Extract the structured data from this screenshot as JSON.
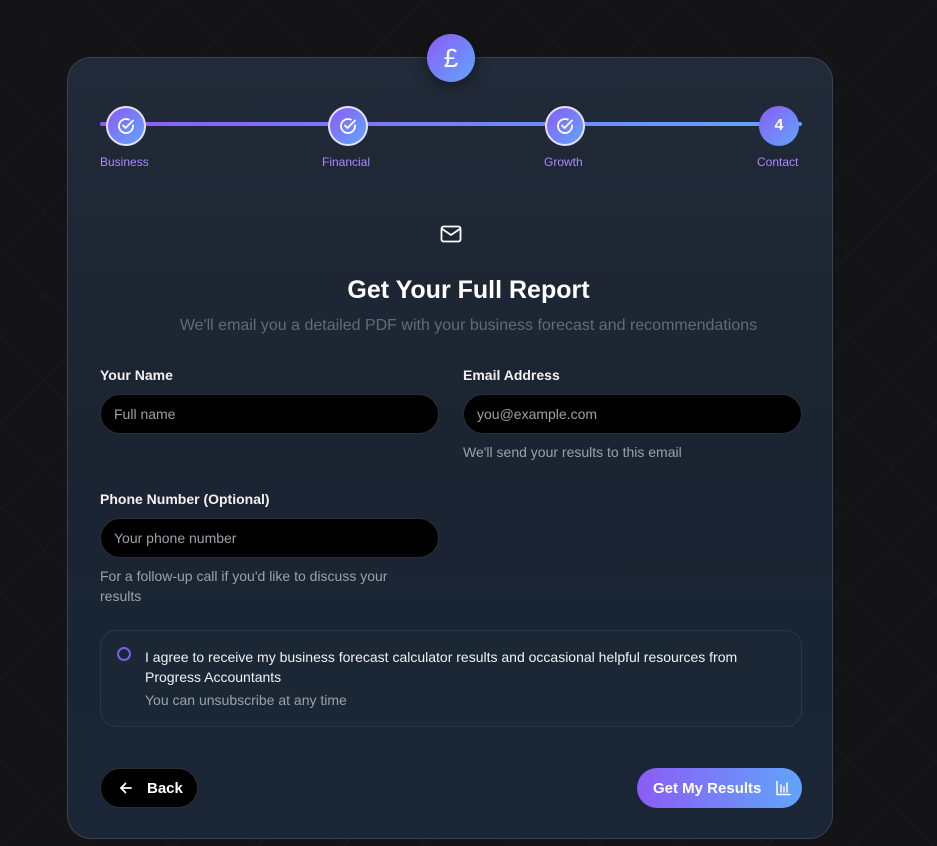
{
  "badge": {
    "symbol": "£",
    "icon": "pound-icon"
  },
  "steps": [
    {
      "label": "Business",
      "state": "done"
    },
    {
      "label": "Financial",
      "state": "done"
    },
    {
      "label": "Growth",
      "state": "done"
    },
    {
      "label": "Contact",
      "state": "current",
      "number": "4"
    }
  ],
  "header": {
    "icon": "mail-icon",
    "title": "Get Your Full Report",
    "subtitle": "We'll email you a detailed PDF with your business forecast and recommendations"
  },
  "form": {
    "name": {
      "label": "Your Name",
      "placeholder": "Full name"
    },
    "email": {
      "label": "Email Address",
      "placeholder": "you@example.com",
      "hint": "We'll send your results to this email"
    },
    "phone": {
      "label": "Phone Number (Optional)",
      "placeholder": "Your phone number",
      "hint": "For a follow-up call if you'd like to discuss your results"
    }
  },
  "consent": {
    "text": "I agree to receive my business forecast calculator results and occasional helpful resources from Progress Accountants",
    "subtext": "You can unsubscribe at any time"
  },
  "actions": {
    "back_label": "Back",
    "submit_label": "Get My Results"
  },
  "colors": {
    "accent_start": "#8b5cf6",
    "accent_end": "#60a5fa",
    "step_label": "#a78bfa"
  }
}
